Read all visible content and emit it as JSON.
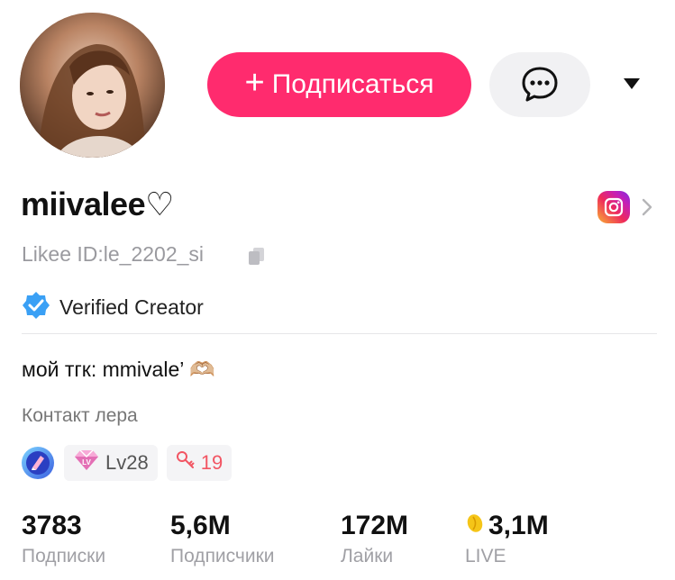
{
  "profile": {
    "username": "miivalee♡",
    "likee_id": "Likee ID:le_2202_si",
    "verified_label": "Verified Creator",
    "bio": "мой тгк: mmivale’",
    "bio_emoji": "🫶🏼",
    "contact": "Контакт лера"
  },
  "actions": {
    "follow_plus": "+",
    "follow_label": "Подписаться"
  },
  "badges": {
    "level": "Lv28",
    "fans": "19"
  },
  "stats": [
    {
      "value": "3783",
      "label": "Подписки"
    },
    {
      "value": "5,6M",
      "label": "Подписчики"
    },
    {
      "value": "172M",
      "label": "Лайки"
    },
    {
      "value": "3,1M",
      "label": "LIVE"
    }
  ],
  "colors": {
    "accent": "#ff2b6e",
    "verified": "#3aa0f5",
    "fans": "#f25563"
  },
  "icons": [
    "avatar",
    "chat-bubble-icon",
    "dropdown-arrow-icon",
    "instagram-icon",
    "chevron-right-icon",
    "copy-icon",
    "verified-badge-icon",
    "level-badge-icon",
    "fans-key-icon",
    "bean-icon"
  ]
}
